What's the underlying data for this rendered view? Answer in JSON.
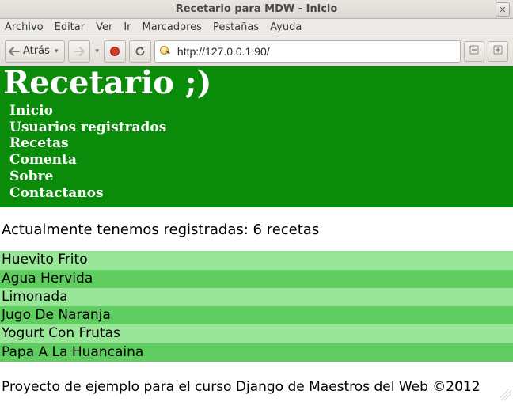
{
  "window": {
    "title": "Recetario para MDW - Inicio"
  },
  "menu": {
    "items": [
      "Archivo",
      "Editar",
      "Ver",
      "Ir",
      "Marcadores",
      "Pestañas",
      "Ayuda"
    ]
  },
  "toolbar": {
    "back_label": "Atrás",
    "url": "http://127.0.0.1:90/"
  },
  "site": {
    "title": "Recetario ;)",
    "nav": [
      "Inicio",
      "Usuarios registrados",
      "Recetas",
      "Comenta",
      "Sobre",
      "Contactanos"
    ],
    "summary": "Actualmente tenemos registradas: 6 recetas",
    "recipes": [
      "Huevito Frito",
      "Agua Hervida",
      "Limonada",
      "Jugo De Naranja",
      "Yogurt Con Frutas",
      "Papa A La Huancaina"
    ],
    "footer": "Proyecto de ejemplo para el curso Django de Maestros del Web ©2012"
  }
}
